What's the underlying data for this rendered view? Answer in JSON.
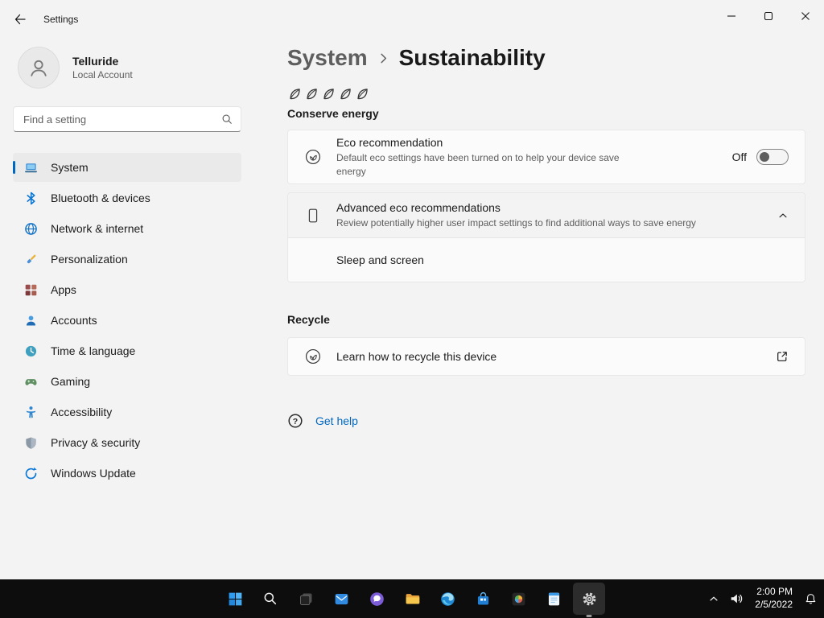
{
  "titlebar": {
    "title": "Settings",
    "controls": [
      "minimize",
      "maximize",
      "close"
    ]
  },
  "sidebar": {
    "user": {
      "name": "Telluride",
      "account_type": "Local Account"
    },
    "search": {
      "placeholder": "Find a setting"
    },
    "items": [
      {
        "label": "System",
        "icon": "system-laptop-icon",
        "selected": true
      },
      {
        "label": "Bluetooth & devices",
        "icon": "bluetooth-icon",
        "selected": false
      },
      {
        "label": "Network & internet",
        "icon": "network-globe-icon",
        "selected": false
      },
      {
        "label": "Personalization",
        "icon": "personalization-brush-icon",
        "selected": false
      },
      {
        "label": "Apps",
        "icon": "apps-grid-icon",
        "selected": false
      },
      {
        "label": "Accounts",
        "icon": "accounts-person-icon",
        "selected": false
      },
      {
        "label": "Time & language",
        "icon": "clock-icon",
        "selected": false
      },
      {
        "label": "Gaming",
        "icon": "gaming-controller-icon",
        "selected": false
      },
      {
        "label": "Accessibility",
        "icon": "accessibility-person-icon",
        "selected": false
      },
      {
        "label": "Privacy & security",
        "icon": "privacy-shield-icon",
        "selected": false
      },
      {
        "label": "Windows Update",
        "icon": "windows-update-icon",
        "selected": false
      }
    ]
  },
  "main": {
    "breadcrumb": {
      "parent": "System",
      "current": "Sustainability"
    },
    "conserve_section": {
      "leaf_icons": 5,
      "label": "Conserve energy",
      "eco_card": {
        "title": "Eco recommendation",
        "description": "Default eco settings have been turned on to help your device save energy",
        "toggle_state": "Off"
      },
      "advanced_card": {
        "title": "Advanced eco recommendations",
        "description": "Review potentially higher user impact settings to find additional ways to save energy",
        "expanded": true,
        "expanded_item": "Sleep and screen"
      }
    },
    "recycle_section": {
      "label": "Recycle",
      "link_card": {
        "title": "Learn how to recycle this device"
      }
    },
    "get_help": {
      "label": "Get help"
    }
  },
  "taskbar": {
    "apps": [
      "start",
      "search",
      "task-view",
      "mail",
      "chat",
      "file-explorer",
      "edge",
      "store",
      "photos",
      "notepad",
      "settings"
    ],
    "active_app": "settings",
    "tray": {
      "time": "2:00 PM",
      "date": "2/5/2022"
    }
  },
  "colors": {
    "accent": "#0067c0",
    "page_background": "#f3f3f3",
    "card_background": "#fbfbfb",
    "taskbar_background": "#0d0d0d"
  }
}
